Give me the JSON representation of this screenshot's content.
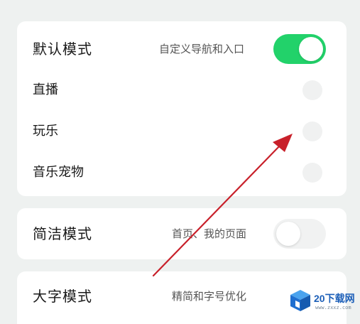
{
  "default_mode": {
    "title": "默认模式",
    "description": "自定义导航和入口",
    "enabled": true,
    "items": [
      {
        "label": "直播"
      },
      {
        "label": "玩乐"
      },
      {
        "label": "音乐宠物"
      }
    ]
  },
  "simple_mode": {
    "title": "简洁模式",
    "description": "首页、我的页面",
    "enabled": false
  },
  "large_font_mode": {
    "title": "大字模式",
    "description": "精简和字号优化"
  },
  "watermark": {
    "text": "20下载网",
    "url": "www.zxxz.com"
  },
  "colors": {
    "toggle_on": "#22d26a",
    "toggle_off": "#f1f2f2",
    "arrow": "#c8202a",
    "background": "#eef1f0"
  },
  "icons": [
    "annotation-arrow-icon",
    "site-logo-icon"
  ]
}
